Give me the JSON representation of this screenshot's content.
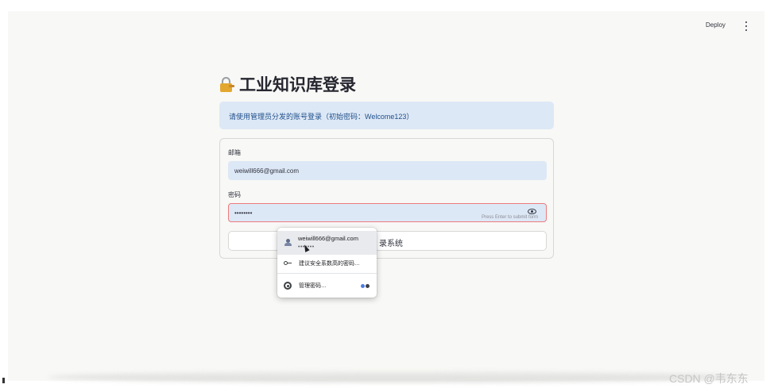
{
  "header": {
    "deploy_label": "Deploy"
  },
  "page": {
    "title": "工业知识库登录",
    "info_message": "请使用管理员分发的账号登录（初始密码：Welcome123）"
  },
  "form": {
    "email_label": "邮箱",
    "email_value": "weiwill666@gmail.com",
    "password_label": "密码",
    "password_value": "••••••••",
    "password_hint": "Press Enter to submit form",
    "submit_label": "录系统"
  },
  "autofill_popup": {
    "saved_email": "weiwill666@gmail.com",
    "saved_password_mask": "•••••••",
    "suggest_label": "建议安全系数高的密码…",
    "manage_label": "管理密码…"
  },
  "watermark": "CSDN @韦东东",
  "colors": {
    "info_bg": "#dde8f6",
    "input_bg": "#dde8f6",
    "focus_border": "#ee7a7a",
    "info_text": "#1f4f8a"
  }
}
